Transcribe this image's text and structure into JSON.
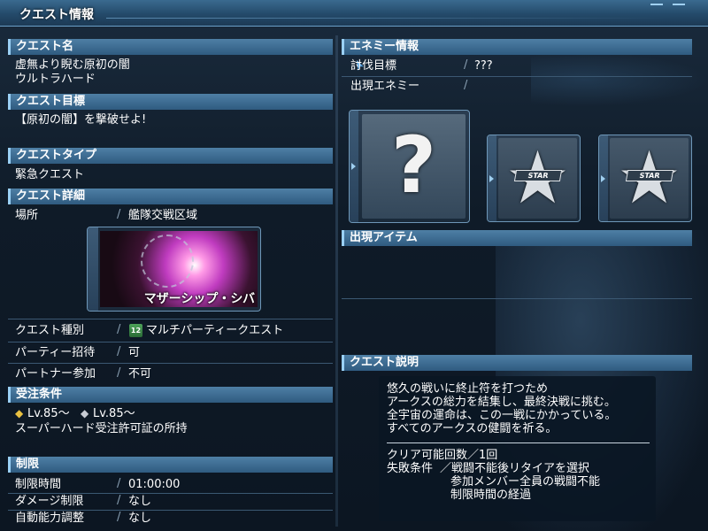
{
  "window": {
    "title": "クエスト情報"
  },
  "sections": {
    "quest_name": "クエスト名",
    "quest_goal": "クエスト目標",
    "quest_type": "クエストタイプ",
    "quest_detail": "クエスト詳細",
    "requirements": "受注条件",
    "limits": "制限",
    "enemy_info": "エネミー情報",
    "items": "出現アイテム",
    "description": "クエスト説明"
  },
  "quest": {
    "name_line1": "虚無より睨む原初の闇",
    "name_line2": "ウルトラハード",
    "goal": "【原初の闇】を撃破せよ!",
    "type": "緊急クエスト",
    "location_label": "場所",
    "location_value": "艦隊交戦区域",
    "image_caption": "マザーシップ・シバ",
    "kind_label": "クエスト種別",
    "kind_value": "マルチパーティークエスト",
    "kind_icon": "12",
    "party_invite_label": "パーティー招待",
    "party_invite_value": "可",
    "partner_label": "パートナー参加",
    "partner_value": "不可"
  },
  "requirements": {
    "main_level": "Lv.85〜",
    "sub_level": "Lv.85〜",
    "license": "スーパーハード受注許可証の所持"
  },
  "limits": {
    "time_label": "制限時間",
    "time_value": "01:00:00",
    "damage_label": "ダメージ制限",
    "damage_value": "なし",
    "auto_label": "自動能力調整",
    "auto_value": "なし"
  },
  "enemy": {
    "target_label": "討伐目標",
    "target_value": "???",
    "appear_label": "出現エネミー",
    "appear_value": "",
    "unknown_mark": "?",
    "badge_text": "STAR"
  },
  "description": {
    "lines": [
      "悠久の戦いに終止符を打つため",
      "アークスの総力を結集し、最終決戦に挑む。",
      "全宇宙の運命は、この一戦にかかっている。",
      "すべてのアークスの健闘を祈る。"
    ],
    "clear_count": "クリア可能回数／1回",
    "fail_label": "失敗条件",
    "fail_conditions": [
      "／戦闘不能後リタイアを選択",
      "参加メンバー全員の戦闘不能",
      "制限時間の経過"
    ]
  },
  "colors": {
    "header_bar": "#3e6d93",
    "header_accent": "#9ad0f5",
    "background": "#0f1b28"
  }
}
